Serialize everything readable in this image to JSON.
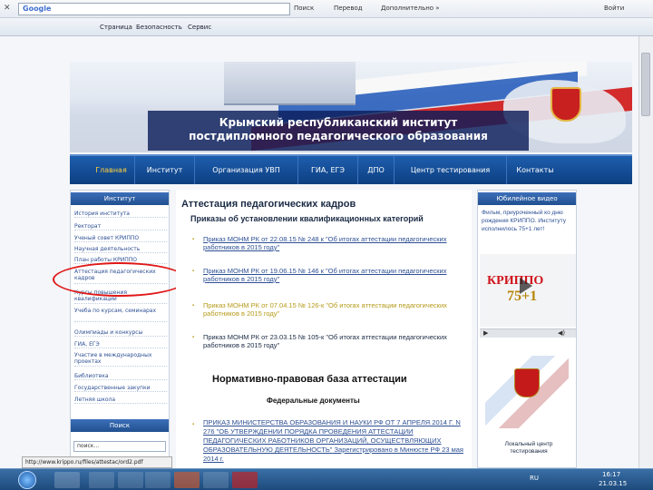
{
  "browser": {
    "close_glyph": "✕",
    "search_engine": "Google",
    "search_placeholder": "",
    "toolbar_items": [
      "Поиск",
      "Перевод",
      "Дополнительно »"
    ],
    "user": "Войти",
    "cmd_items": [
      "Страница",
      "Безопасность",
      "Сервис"
    ]
  },
  "banner": {
    "line1": "Крымский республиканский институт",
    "line2": "постдипломного педагогического образования"
  },
  "nav": [
    "Главная",
    "Институт",
    "Организация УВП",
    "ГИА, ЕГЭ",
    "ДПО",
    "Центр тестирования",
    "Контакты"
  ],
  "left": {
    "header": "Институт",
    "items": [
      "История института",
      "Ректорат",
      "Ученый совет КРИППО",
      "Научная деятельность",
      "План работы КРИППО",
      "Аттестация педагогических кадров",
      "Курсы повышения квалификации",
      "Учеба по курсам, семинарах",
      "Олимпиады и конкурсы",
      "ГИА, ЕГЭ",
      "Участие в международных проектах",
      "Библиотека",
      "Государственные закупки",
      "Летняя школа"
    ],
    "search_header": "Поиск",
    "search_value": "поиск..."
  },
  "main": {
    "title": "Аттестация педагогических кадров",
    "subtitle": "Приказы об установлении квалификационных категорий",
    "orders": [
      "Приказ МОНМ РК от 22.08.15 № 248 к \"Об итогах аттестации педагогических работников в 2015 году\"",
      "Приказ МОНМ РК от 19.06.15 № 146 к \"Об итогах аттестации педагогических работников в 2015 году\"",
      "Приказ МОНМ РК от 07.04.15 № 126-к \"Об итогах аттестации педагогических работников в 2015 году\"",
      "Приказ МОНМ РК от 23.03.15 № 105-к \"Об итогах аттестации педагогических работников в 2015 году\""
    ],
    "section_title": "Нормативно-правовая база аттестации",
    "section_sub": "Федеральные документы",
    "doc_link": "ПРИКАЗ МИНИСТЕРСТВА ОБРАЗОВАНИЯ И НАУКИ РФ ОТ 7 АПРЕЛЯ 2014 Г. N 276 \"ОБ УТВЕРЖДЕНИИ ПОРЯДКА ПРОВЕДЕНИЯ АТТЕСТАЦИИ ПЕДАГОГИЧЕСКИХ РАБОТНИКОВ ОРГАНИЗАЦИЙ, ОСУЩЕСТВЛЯЮЩИХ ОБРАЗОВАТЕЛЬНУЮ ДЕЯТЕЛЬНОСТЬ\"",
    "doc_note": "Зарегистрировано в Минюсте РФ 23 мая 2014 г."
  },
  "right": {
    "header": "Юбилейное видео",
    "text": "Фильм, приуроченный ко дню рождения КРИППО. Институту исполнилось 75+1 лет!",
    "video_label": "КРИППО",
    "video_sub": "75+1",
    "center_label": "Локальный центр тестирования"
  },
  "status_url": "http://www.krippo.ru/files/attestac/ord2.pdf",
  "clock": {
    "time": "16:17",
    "date": "21.03.15"
  },
  "lang": "RU",
  "colors": {
    "nav": "#0c3f80",
    "link": "#2d4f94",
    "order_link": "#b59a18",
    "red_oval": "#e01818"
  }
}
